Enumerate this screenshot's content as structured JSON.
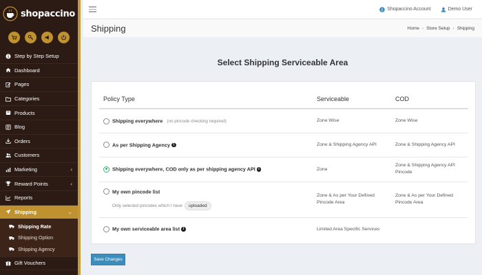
{
  "brand": {
    "name": "shopaccino",
    "accent": "#c0922f",
    "sidebar_bg": "#2b1b14"
  },
  "quick_icons": [
    "cart-icon",
    "key-icon",
    "megaphone-icon",
    "power-icon"
  ],
  "sidebar": {
    "items": [
      {
        "label": "Step by Step Setup",
        "icon": "info-circle-icon"
      },
      {
        "label": "Dashboard",
        "icon": "home-icon"
      },
      {
        "label": "Pages",
        "icon": "edit-icon"
      },
      {
        "label": "Categories",
        "icon": "folder-icon"
      },
      {
        "label": "Products",
        "icon": "box-icon"
      },
      {
        "label": "Blog",
        "icon": "blog-icon"
      },
      {
        "label": "Orders",
        "icon": "download-icon"
      },
      {
        "label": "Customers",
        "icon": "users-icon"
      },
      {
        "label": "Marketing",
        "icon": "chart-icon",
        "chevron": "‹"
      },
      {
        "label": "Reward Points",
        "icon": "trophy-icon",
        "chevron": "‹"
      },
      {
        "label": "Reports",
        "icon": "report-icon"
      },
      {
        "label": "Shipping",
        "icon": "plane-icon",
        "chevron": "⌄"
      }
    ],
    "submenu": [
      {
        "label": "Shipping Rate",
        "icon": "truck-icon"
      },
      {
        "label": "Shipping Option",
        "icon": "truck-icon"
      },
      {
        "label": "Shipping Agency",
        "icon": "truck-icon"
      }
    ],
    "after": {
      "label": "Gift Vouchers",
      "icon": "gift-icon"
    }
  },
  "topbar": {
    "account_label": "Shopaccino Account",
    "user_label": "Demo User"
  },
  "header": {
    "title": "Shipping",
    "breadcrumb": [
      "Home",
      "Store Setup",
      "Shipping"
    ]
  },
  "main": {
    "section_title": "Select Shipping Serviceable Area",
    "columns": [
      "Policy Type",
      "Serviceable",
      "COD"
    ],
    "rows": [
      {
        "policy": "Shipping everywhere",
        "note": "(no pincode checking required)",
        "serviceable": "Zone Wise",
        "cod": "Zone Wise",
        "checked": false,
        "info": false
      },
      {
        "policy": "As per Shipping Agency",
        "note": "",
        "serviceable": "Zone & Shipping Agency API",
        "cod": "Zone & Shipping Agency API",
        "checked": false,
        "info": true
      },
      {
        "policy": "Shipping everywhere, COD only as per shipping agency API",
        "note": "",
        "serviceable": "Zone",
        "cod": "Zone & Shipping Agency API Pincode",
        "checked": true,
        "info": true
      },
      {
        "policy": "My own pincode list",
        "note": "",
        "sub_note": "Only selected pincodes which I have",
        "sub_pill": "uploaded",
        "serviceable": "Zone & As per Your Defined Pincode Area",
        "cod": "Zone & As per Your Defined Pincode Area",
        "checked": false,
        "info": false
      },
      {
        "policy": "My own serviceable area list",
        "note": "",
        "serviceable": "Limited Area Specific Services",
        "cod": "",
        "checked": false,
        "info": true
      }
    ],
    "info_glyph": "i",
    "save_label": "Save Changes"
  }
}
